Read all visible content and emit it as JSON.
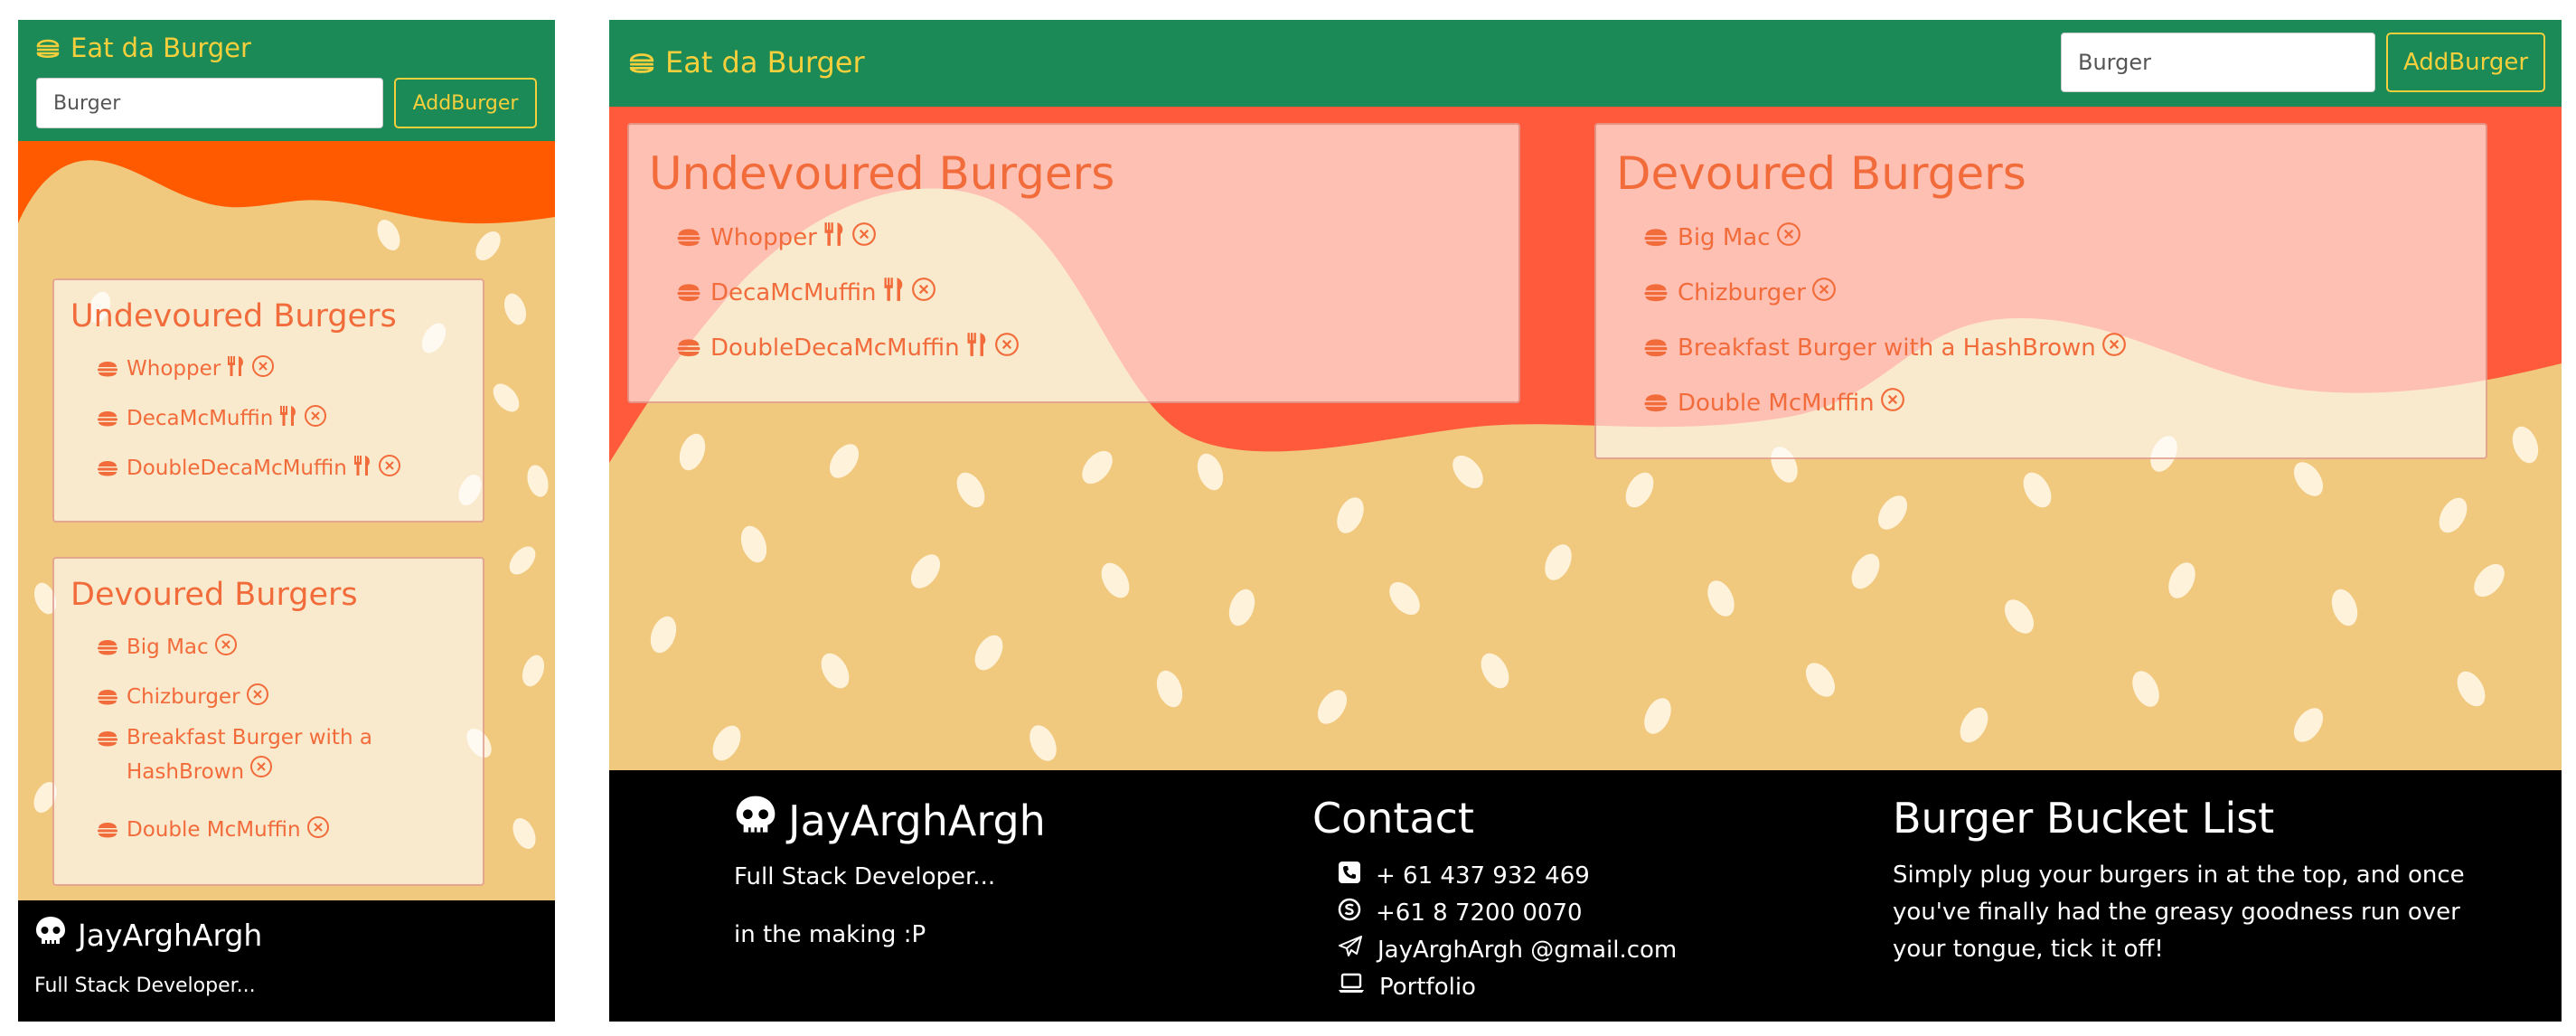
{
  "navbar": {
    "brand": "Eat da Burger",
    "input_value": "Burger",
    "add_button": "AddBurger"
  },
  "undevoured": {
    "title": "Undevoured Burgers",
    "items": [
      "Whopper",
      "DecaMcMuffin",
      "DoubleDecaMcMuffin"
    ]
  },
  "devoured": {
    "title": "Devoured Burgers",
    "items": [
      "Big Mac",
      "Chizburger",
      "Breakfast Burger with a HashBrown",
      "Double McMuffin"
    ],
    "mobile_items": [
      "Big Mac",
      "Chizburger",
      "Breakfast Burger with a",
      "HashBrown",
      "Double McMuffin"
    ]
  },
  "footer": {
    "name": "JayArghArgh",
    "tagline": "Full Stack Developer...",
    "tagline2": "in the making :P",
    "contact_title": "Contact",
    "contacts": [
      "+ 61 437 932 469",
      "+61 8 7200 0070",
      "JayArghArgh @gmail.com",
      "Portfolio"
    ],
    "bucket_title": "Burger Bucket List",
    "bucket_lines": [
      "Simply plug your burgers in at the top, and once",
      "you've finally had the greasy goodness run over",
      "your tongue, tick it off!"
    ]
  },
  "colors": {
    "navbar": "#1b8a57",
    "brand": "#f5cf3c",
    "bun": "#f0c97f",
    "sauce_mobile": "#ff5a00",
    "sauce_desktop": "#ff5a3c",
    "accent": "#f26b3a",
    "footer": "#000000"
  },
  "icons": {
    "brand": "burger-outline-icon",
    "item": "hamburger-icon",
    "eat": "utensils-icon",
    "remove": "circle-x-icon",
    "footer_name": "skull-icon",
    "phone": "phone-square-icon",
    "skype": "skype-icon",
    "email": "paper-plane-icon",
    "portfolio": "laptop-icon"
  }
}
